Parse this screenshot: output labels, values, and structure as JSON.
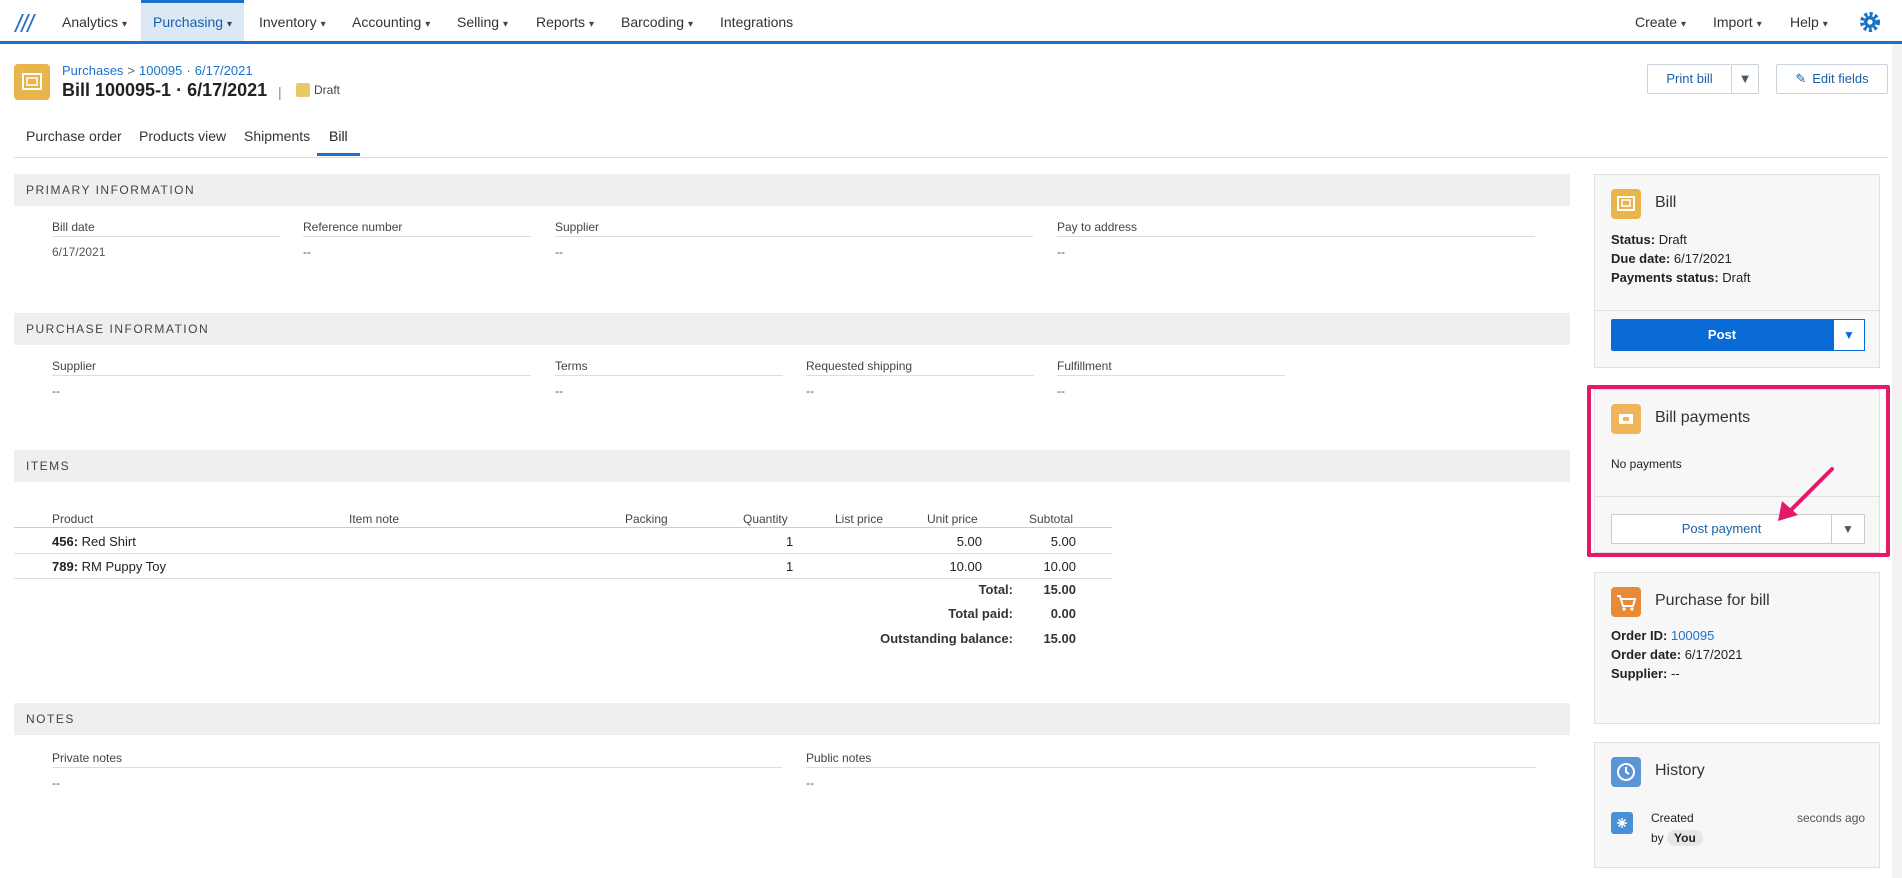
{
  "nav": {
    "items": [
      {
        "label": "Analytics",
        "chev": "▾"
      },
      {
        "label": "Purchasing",
        "chev": "▾"
      },
      {
        "label": "Inventory",
        "chev": "▾"
      },
      {
        "label": "Accounting",
        "chev": "▾"
      },
      {
        "label": "Selling",
        "chev": "▾"
      },
      {
        "label": "Reports",
        "chev": "▾"
      },
      {
        "label": "Barcoding",
        "chev": "▾"
      },
      {
        "label": "Integrations",
        "chev": ""
      }
    ],
    "right": [
      {
        "label": "Create",
        "chev": "▾"
      },
      {
        "label": "Import",
        "chev": "▾"
      },
      {
        "label": "Help",
        "chev": "▾"
      }
    ],
    "active": "Purchasing",
    "accent": "#1a73c8"
  },
  "header": {
    "breadcrumb": [
      "Purchases",
      "100095",
      "6/17/2021"
    ],
    "breadcrumb_sep": ">",
    "breadcrumb_dot": "·",
    "title": "Bill 100095-1 · 6/17/2021",
    "title_sep": "|",
    "status_badge": "Draft",
    "print_label": "Print bill",
    "caret": "▼",
    "edit_label": "Edit fields",
    "edit_icon": "✎"
  },
  "tabs": [
    "Purchase order",
    "Products view",
    "Shipments",
    "Bill"
  ],
  "primary": {
    "heading": "PRIMARY INFORMATION",
    "fields": [
      {
        "label": "Bill date",
        "value": "6/17/2021"
      },
      {
        "label": "Reference number",
        "value": "--"
      },
      {
        "label": "Supplier",
        "value": "--"
      },
      {
        "label": "Pay to address",
        "value": "--"
      }
    ]
  },
  "purchase": {
    "heading": "PURCHASE INFORMATION",
    "fields": [
      {
        "label": "Supplier",
        "value": "--"
      },
      {
        "label": "Terms",
        "value": "--"
      },
      {
        "label": "Requested shipping",
        "value": "--"
      },
      {
        "label": "Fulfillment",
        "value": "--"
      }
    ]
  },
  "items": {
    "heading": "ITEMS",
    "columns": [
      "Product",
      "Item note",
      "Packing",
      "Quantity",
      "List price",
      "Unit price",
      "Subtotal"
    ],
    "rows": [
      {
        "sku": "456:",
        "name": "Red Shirt",
        "quantity": "1",
        "unit_price": "5.00",
        "subtotal": "5.00"
      },
      {
        "sku": "789:",
        "name": "RM Puppy Toy",
        "quantity": "1",
        "unit_price": "10.00",
        "subtotal": "10.00"
      }
    ],
    "totals": [
      {
        "label": "Total:",
        "value": "15.00"
      },
      {
        "label": "Total paid:",
        "value": "0.00"
      },
      {
        "label": "Outstanding balance:",
        "value": "15.00"
      }
    ]
  },
  "notes": {
    "heading": "NOTES",
    "fields": [
      {
        "label": "Private notes",
        "value": "--"
      },
      {
        "label": "Public notes",
        "value": "--"
      }
    ]
  },
  "bill_panel": {
    "title": "Bill",
    "status_label": "Status:",
    "status": "Draft",
    "due_label": "Due date:",
    "due": "6/17/2021",
    "payments_status_label": "Payments status:",
    "payments_status": "Draft",
    "post_label": "Post",
    "caret": "▼"
  },
  "payments_panel": {
    "title": "Bill payments",
    "empty": "No payments",
    "post_payment_label": "Post payment",
    "caret": "▼"
  },
  "purchase_panel": {
    "title": "Purchase for bill",
    "order_id_label": "Order ID:",
    "order_id": "100095",
    "order_date_label": "Order date:",
    "order_date": "6/17/2021",
    "supplier_label": "Supplier:",
    "supplier": "--"
  },
  "history_panel": {
    "title": "History",
    "event": "Created",
    "by_label": "by",
    "by": "You",
    "when": "seconds ago"
  },
  "colors": {
    "highlight": "#e6186b",
    "bill_icon": "#e9b54a",
    "primary_button": "#0a6ad6"
  }
}
